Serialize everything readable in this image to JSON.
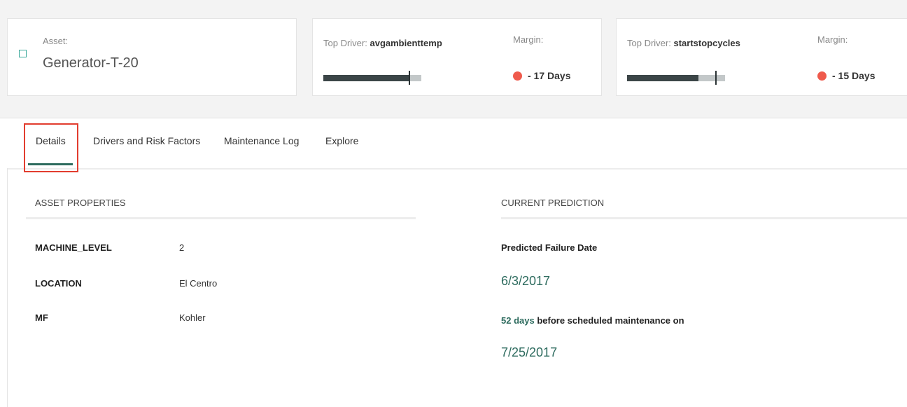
{
  "asset": {
    "label": "Asset:",
    "name": "Generator-T-20"
  },
  "drivers": [
    {
      "label": "Top Driver:",
      "name": "avgambienttemp",
      "margin_label": "Margin:",
      "margin_value": "- 17 Days",
      "status_color": "#ef5a4c",
      "bar_fraction": 0.87,
      "bar_marker_fraction": 0.87
    },
    {
      "label": "Top Driver:",
      "name": "startstopcycles",
      "margin_label": "Margin:",
      "margin_value": "- 15 Days",
      "status_color": "#ef5a4c",
      "bar_fraction": 0.73,
      "bar_marker_fraction": 0.9
    }
  ],
  "tabs": [
    {
      "label": "Details",
      "active": true
    },
    {
      "label": "Drivers and Risk Factors"
    },
    {
      "label": "Maintenance Log"
    },
    {
      "label": "Explore"
    }
  ],
  "asset_properties": {
    "title": "ASSET PROPERTIES",
    "rows": [
      {
        "key": "MACHINE_LEVEL",
        "value": "2"
      },
      {
        "key": "LOCATION",
        "value": "El Centro"
      },
      {
        "key": "MF",
        "value": "Kohler"
      }
    ]
  },
  "current_prediction": {
    "title": "CURRENT PREDICTION",
    "heading": "Predicted Failure Date",
    "failure_date": "6/3/2017",
    "days": "52 days",
    "days_suffix": " before scheduled maintenance on",
    "maintenance_date": "7/25/2017"
  },
  "colors": {
    "accent": "#2d6b5e",
    "alert": "#ef5a4c",
    "highlight_box": "#e23d2f"
  },
  "icons": {
    "asset": "square-outline-icon",
    "status": "red-dot-icon"
  }
}
